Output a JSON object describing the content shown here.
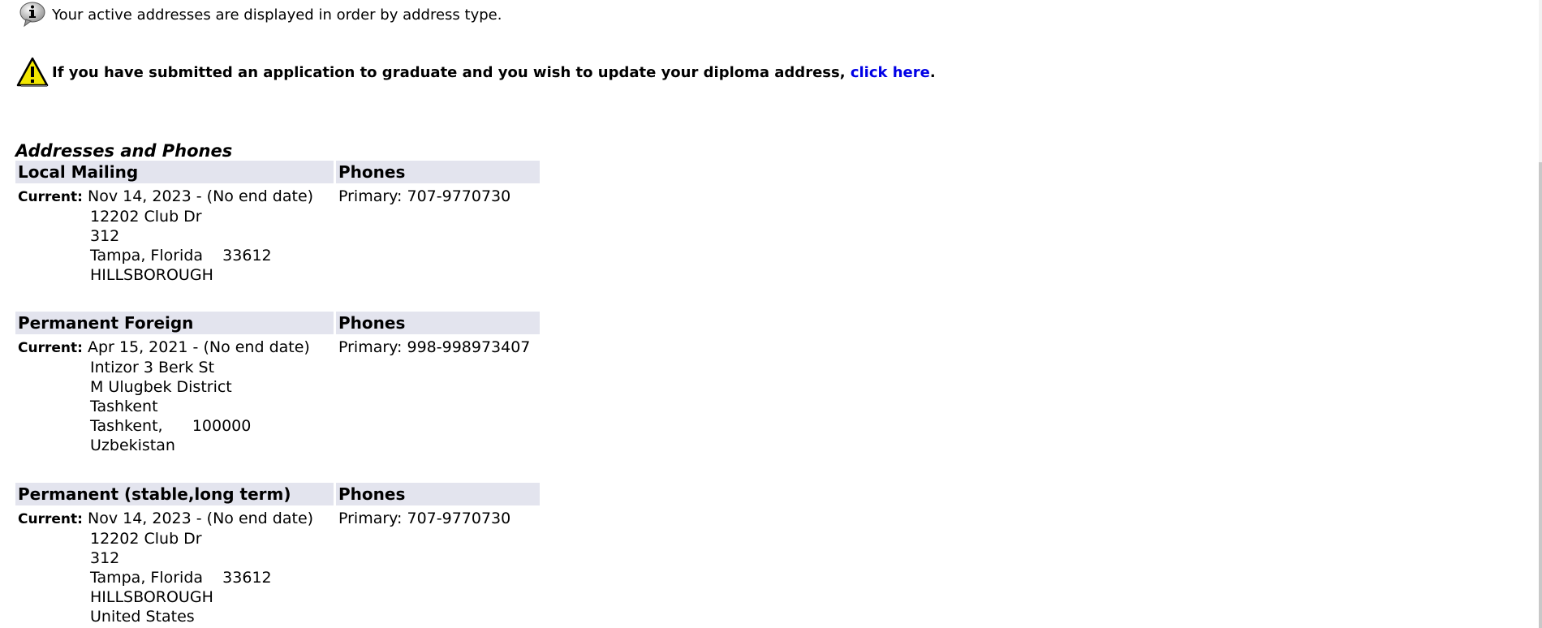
{
  "info": {
    "icon": "info-icon",
    "text": "Your active addresses are displayed in order by address type."
  },
  "warning": {
    "icon": "warning-icon",
    "text": "If you have submitted an application to graduate and you wish to update your diploma address,",
    "link_text": "click here",
    "suffix": ".",
    "link_color": "#0000e6"
  },
  "section_title": "Addresses and Phones",
  "addresses": [
    {
      "type": "Local Mailing",
      "phones_header": "Phones",
      "status": "Current:",
      "dates": "Nov 14, 2023 - (No end date)",
      "phone": "Primary: 707-9770730",
      "lines": [
        "12202 Club Dr",
        "312",
        "Tampa, Florida    33612",
        "HILLSBOROUGH"
      ]
    },
    {
      "type": "Permanent Foreign",
      "phones_header": "Phones",
      "status": "Current:",
      "dates": "Apr 15, 2021 - (No end date)",
      "phone": "Primary: 998-998973407",
      "lines": [
        "Intizor 3 Berk St",
        "M Ulugbek District",
        "Tashkent",
        "Tashkent,      100000",
        "Uzbekistan"
      ]
    },
    {
      "type": "Permanent (stable,long term)",
      "phones_header": "Phones",
      "status": "Current:",
      "dates": "Nov 14, 2023 - (No end date)",
      "phone": "Primary: 707-9770730",
      "lines": [
        "12202 Club Dr",
        "312",
        "Tampa, Florida    33612",
        "HILLSBOROUGH",
        "United States"
      ]
    }
  ],
  "colors": {
    "header_bg": "#e3e4ee",
    "link": "#0000e6"
  }
}
